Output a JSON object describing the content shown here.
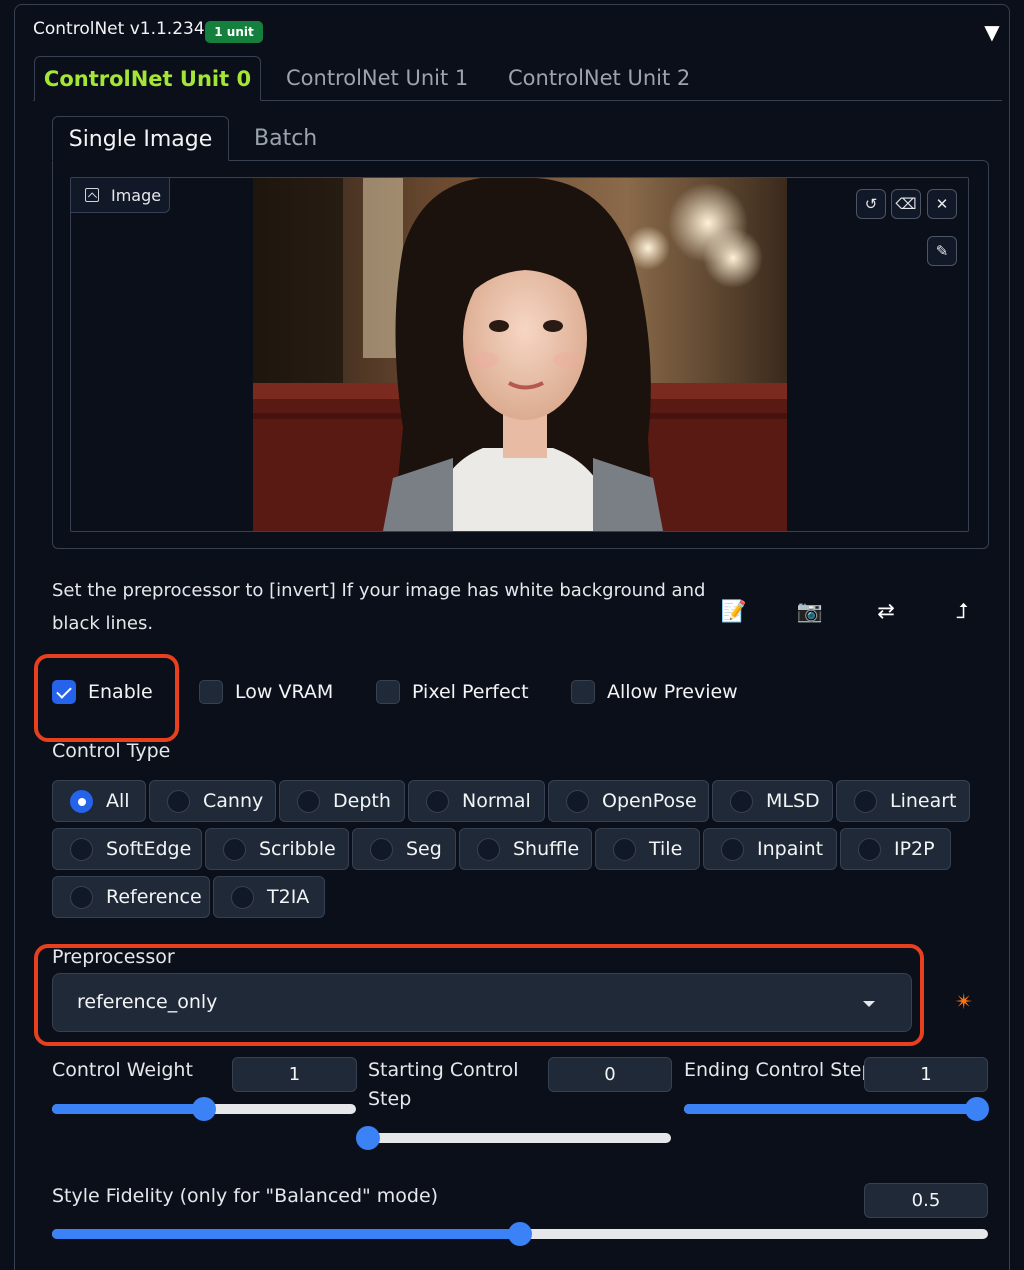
{
  "header": {
    "title": "ControlNet v1.1.234",
    "badge": "1 unit",
    "collapse_icon": "triangle-down-icon"
  },
  "unit_tabs": [
    {
      "label": "ControlNet Unit 0",
      "active": true
    },
    {
      "label": "ControlNet Unit 1",
      "active": false
    },
    {
      "label": "ControlNet Unit 2",
      "active": false
    }
  ],
  "mode_tabs": [
    {
      "label": "Single Image",
      "active": true
    },
    {
      "label": "Batch",
      "active": false
    }
  ],
  "image_panel": {
    "label": "Image",
    "tools": [
      "undo-icon",
      "eraser-icon",
      "close-icon",
      "brush-icon"
    ]
  },
  "hint": "Set the preprocessor to [invert] If your image has white background and black lines.",
  "actions": [
    "memo-icon",
    "camera-icon",
    "swap-arrows-icon",
    "arrow-up-icon"
  ],
  "checkboxes": [
    {
      "label": "Enable",
      "checked": true
    },
    {
      "label": "Low VRAM",
      "checked": false
    },
    {
      "label": "Pixel Perfect",
      "checked": false
    },
    {
      "label": "Allow Preview",
      "checked": false
    }
  ],
  "control_type": {
    "label": "Control Type",
    "selected": "All",
    "options": [
      "All",
      "Canny",
      "Depth",
      "Normal",
      "OpenPose",
      "MLSD",
      "Lineart",
      "SoftEdge",
      "Scribble",
      "Seg",
      "Shuffle",
      "Tile",
      "Inpaint",
      "IP2P",
      "Reference",
      "T2IA"
    ]
  },
  "preprocessor": {
    "label": "Preprocessor",
    "value": "reference_only",
    "run_icon": "spark-icon"
  },
  "sliders": {
    "control_weight": {
      "label": "Control Weight",
      "value": "1",
      "fraction": 0.5
    },
    "starting_step": {
      "label": "Starting Control Step",
      "label_line1": "Starting Control",
      "label_line2": "Step",
      "value": "0",
      "fraction": 0.0
    },
    "ending_step": {
      "label": "Ending Control Step",
      "value": "1",
      "fraction": 1.0
    },
    "style_fidelity": {
      "label": "Style Fidelity (only for \"Balanced\" mode)",
      "value": "0.5",
      "fraction": 0.5
    }
  },
  "colors": {
    "accent": "#3b82f6",
    "active_tab": "#a3e635",
    "badge": "#15803d",
    "highlight": "#e8401f"
  }
}
